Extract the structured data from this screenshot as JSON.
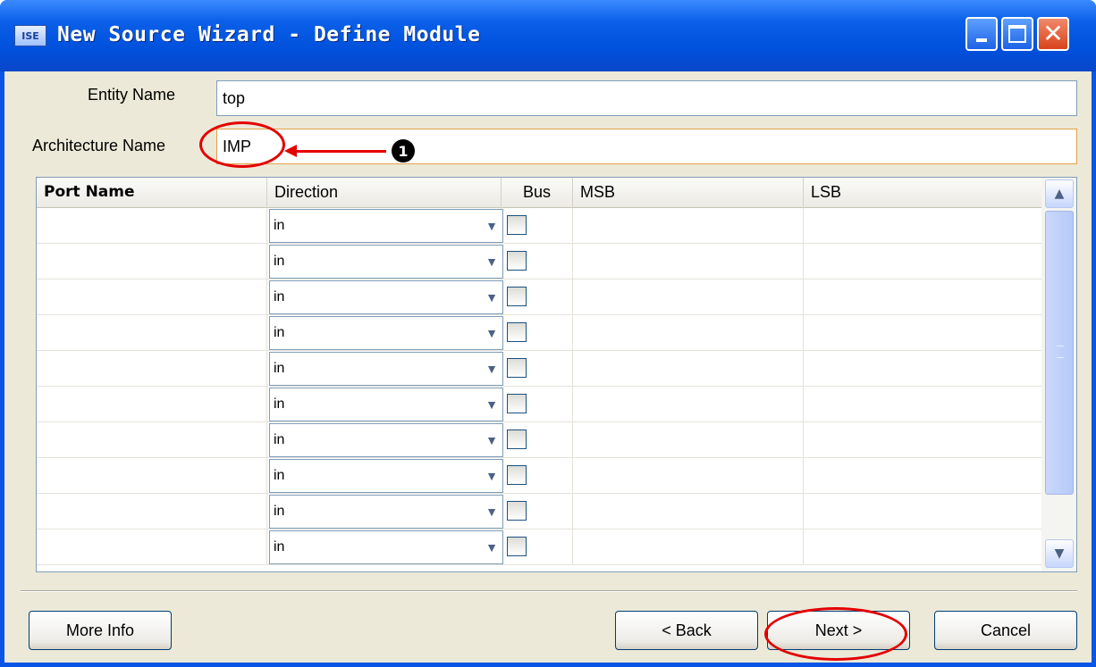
{
  "window": {
    "title": "New Source Wizard - Define Module",
    "app_icon_text": "ISE"
  },
  "form": {
    "entity_label": "Entity Name",
    "entity_value": "top",
    "arch_label": "Architecture Name",
    "arch_value": "IMP"
  },
  "table": {
    "headers": [
      "Port Name",
      "Direction",
      "Bus",
      "MSB",
      "LSB"
    ],
    "rows": [
      {
        "port": "",
        "direction": "in",
        "bus": false,
        "msb": "",
        "lsb": ""
      },
      {
        "port": "",
        "direction": "in",
        "bus": false,
        "msb": "",
        "lsb": ""
      },
      {
        "port": "",
        "direction": "in",
        "bus": false,
        "msb": "",
        "lsb": ""
      },
      {
        "port": "",
        "direction": "in",
        "bus": false,
        "msb": "",
        "lsb": ""
      },
      {
        "port": "",
        "direction": "in",
        "bus": false,
        "msb": "",
        "lsb": ""
      },
      {
        "port": "",
        "direction": "in",
        "bus": false,
        "msb": "",
        "lsb": ""
      },
      {
        "port": "",
        "direction": "in",
        "bus": false,
        "msb": "",
        "lsb": ""
      },
      {
        "port": "",
        "direction": "in",
        "bus": false,
        "msb": "",
        "lsb": ""
      },
      {
        "port": "",
        "direction": "in",
        "bus": false,
        "msb": "",
        "lsb": ""
      },
      {
        "port": "",
        "direction": "in",
        "bus": false,
        "msb": "",
        "lsb": ""
      }
    ]
  },
  "buttons": {
    "more_info": "More Info",
    "back": "< Back",
    "next": "Next >",
    "cancel": "Cancel"
  },
  "annotation": {
    "number": "1",
    "color": "#e30000"
  },
  "icons": {
    "minimize": "minimize-icon",
    "maximize": "maximize-icon",
    "close": "close-icon",
    "dropdown": "chevron-down-icon"
  }
}
